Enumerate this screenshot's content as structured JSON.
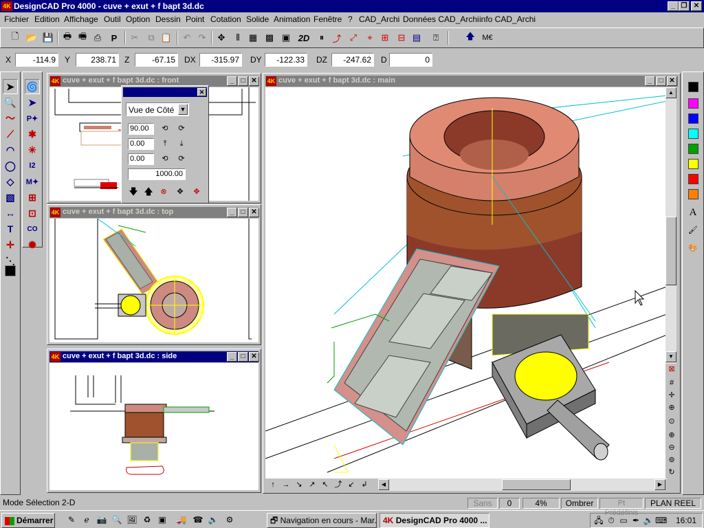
{
  "app": {
    "title": "DesignCAD Pro 4000 - cuve + exut + f bapt 3d.dc",
    "icon_text": "4K"
  },
  "menu": [
    "Fichier",
    "Edition",
    "Affichage",
    "Outil",
    "Option",
    "Dessin",
    "Point",
    "Cotation",
    "Solide",
    "Animation",
    "Fenêtre",
    "?",
    "CAD_Archi",
    "Données CAD_Archi",
    "info CAD_Archi"
  ],
  "toolbar": {
    "view2d_label": "2D",
    "extra_label": "M€"
  },
  "coords": {
    "x_label": "X",
    "x": "-114.9",
    "y_label": "Y",
    "y": "238.71",
    "z_label": "Z",
    "z": "-67.15",
    "dx_label": "DX",
    "dx": "-315.97",
    "dy_label": "DY",
    "dy": "-122.33",
    "dz_label": "DZ",
    "dz": "-247.62",
    "d_label": "D",
    "d": "0"
  },
  "windows": {
    "front": "cuve + exut + f bapt 3d.dc : front",
    "top": "cuve + exut + f bapt 3d.dc : top",
    "side": "cuve + exut + f bapt 3d.dc : side",
    "main": "cuve + exut + f bapt 3d.dc : main"
  },
  "view_panel": {
    "view_select": "Vue de Côté",
    "angle1": "90.00",
    "angle2": "0.00",
    "angle3": "0.00",
    "distance": "1000.00"
  },
  "palette_colors": [
    "#000000",
    "#ff00ff",
    "#0000ff",
    "#00ffff",
    "#00a000",
    "#ffff00",
    "#ff0000",
    "#ff8000"
  ],
  "palette_tools": {
    "text_label": "A"
  },
  "status": {
    "mode": "Mode Sélection 2-D",
    "sans": "Sans",
    "value": "0",
    "percent": "4%",
    "ombrer": "Ombrer",
    "pt_predef": "Pt Prédéfinis",
    "plan": "PLAN REEL"
  },
  "taskbar": {
    "start": "Démarrer",
    "task1": "Navigation en cours - Mar...",
    "task2": "DesignCAD Pro 4000 ...",
    "clock": "16:01"
  }
}
